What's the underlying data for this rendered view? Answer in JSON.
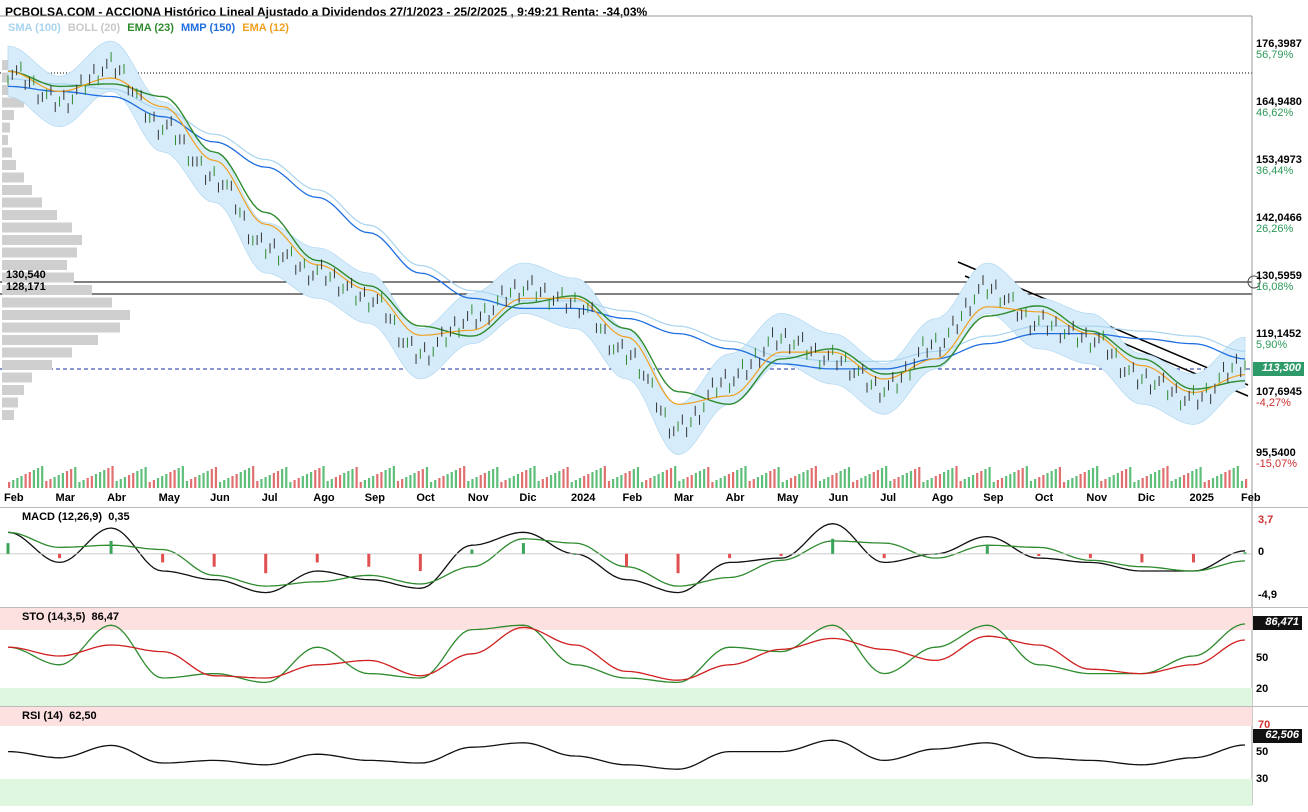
{
  "header": {
    "title": "PCBOLSA.COM - ACCIONA Histórico Lineal Ajustado a Dividendos 27/1/2023 - 25/2/2025 , 9:49:21 Renta: -34,03%"
  },
  "legend": [
    {
      "label": "SMA (100)",
      "color": "#a8d4f0"
    },
    {
      "label": "BOLL (20)",
      "color": "#c8c8c8"
    },
    {
      "label": "EMA (23)",
      "color": "#2e8b2e"
    },
    {
      "label": "MMP (150)",
      "color": "#1f6fe0"
    },
    {
      "label": "EMA (12)",
      "color": "#f0a020"
    }
  ],
  "levels": {
    "level1": "130,540",
    "level2": "128,171",
    "current_price": "113,300"
  },
  "price_axis": [
    {
      "price": "176,3987",
      "pct": "56,79%"
    },
    {
      "price": "164,9480",
      "pct": "46,62%"
    },
    {
      "price": "153,4973",
      "pct": "36,44%"
    },
    {
      "price": "142,0466",
      "pct": "26,26%"
    },
    {
      "price": "130,5959",
      "pct": "16,08%"
    },
    {
      "price": "119,1452",
      "pct": "5,90%"
    },
    {
      "price": "107,6945",
      "pct": "-4,27%"
    },
    {
      "price": "95,5400",
      "pct": "-15,07%"
    }
  ],
  "months": [
    "Feb",
    "Mar",
    "Abr",
    "May",
    "Jun",
    "Jul",
    "Ago",
    "Sep",
    "Oct",
    "Nov",
    "Dic",
    "2024",
    "Feb",
    "Mar",
    "Abr",
    "May",
    "Jun",
    "Jul",
    "Ago",
    "Sep",
    "Oct",
    "Nov",
    "Dic",
    "2025",
    "Feb"
  ],
  "macd": {
    "label": "MACD (12,26,9)",
    "value": "0,35",
    "axis": [
      "3,7",
      "0",
      "-4,9"
    ]
  },
  "sto": {
    "label": "STO (14,3,5)",
    "value": "86,47",
    "current": "86,471",
    "axis": [
      "50",
      "20"
    ]
  },
  "rsi": {
    "label": "RSI (14)",
    "value": "62,50",
    "current": "62,506",
    "axis": [
      "70",
      "50",
      "30"
    ]
  },
  "chart_data": {
    "type": "line",
    "title": "ACCIONA Histórico Lineal Ajustado a Dividendos 27/1/2023 - 25/2/2025",
    "x": [
      "2023-02",
      "2023-03",
      "2023-04",
      "2023-05",
      "2023-06",
      "2023-07",
      "2023-08",
      "2023-09",
      "2023-10",
      "2023-11",
      "2023-12",
      "2024-01",
      "2024-02",
      "2024-03",
      "2024-04",
      "2024-05",
      "2024-06",
      "2024-07",
      "2024-08",
      "2024-09",
      "2024-10",
      "2024-11",
      "2024-12",
      "2025-01",
      "2025-02"
    ],
    "series": [
      {
        "name": "ACCIONA",
        "values": [
          171,
          165,
          172,
          160,
          150,
          136,
          131,
          126,
          115,
          122,
          128,
          125,
          115,
          100,
          110,
          118,
          114,
          108,
          117,
          128,
          121,
          118,
          110,
          106,
          113.3
        ]
      },
      {
        "name": "MMP (150)",
        "values": [
          168,
          167,
          166,
          162,
          157,
          152,
          146,
          139,
          131,
          126,
          124,
          124,
          122,
          119,
          116,
          113,
          112,
          112,
          114,
          117,
          119,
          119,
          118,
          117,
          114
        ]
      }
    ],
    "ylim": [
      95.54,
      176.3987
    ],
    "macd": [
      2.5,
      -1,
      3,
      -2,
      -3,
      -4.5,
      -2,
      -3,
      -4,
      1,
      2.5,
      0,
      -3,
      -4.5,
      -1,
      -0.5,
      3.5,
      -1,
      0,
      2,
      -0.5,
      -1,
      -2,
      -2,
      0.35
    ],
    "sto": [
      60,
      40,
      85,
      25,
      30,
      20,
      60,
      30,
      25,
      80,
      85,
      40,
      25,
      20,
      60,
      55,
      85,
      30,
      60,
      85,
      40,
      30,
      30,
      50,
      86.47
    ],
    "rsi": [
      55,
      48,
      62,
      42,
      45,
      40,
      52,
      45,
      42,
      60,
      65,
      50,
      40,
      35,
      55,
      55,
      68,
      45,
      58,
      65,
      48,
      45,
      40,
      48,
      62.5
    ]
  }
}
